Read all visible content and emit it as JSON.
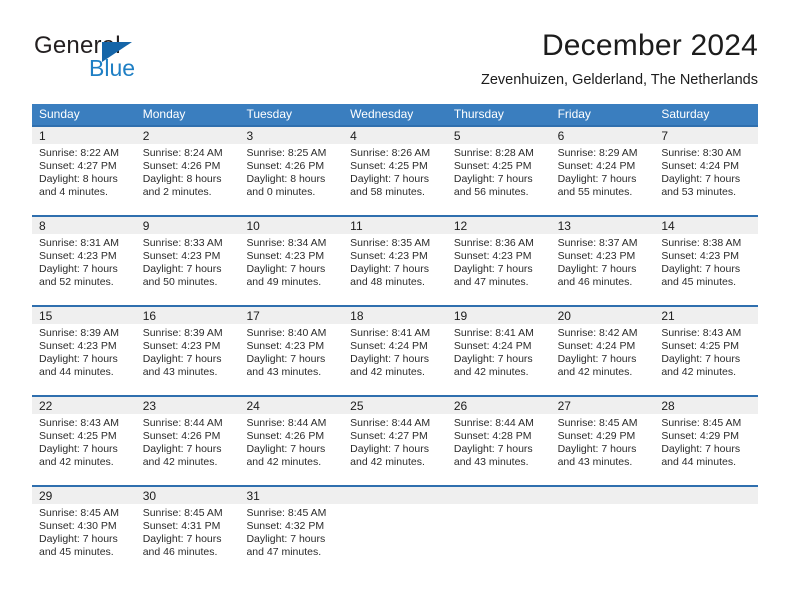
{
  "brand": {
    "name_part1": "General",
    "name_part2": "Blue",
    "triangle_color": "#1565a8",
    "blue_color": "#1f7fc4"
  },
  "header": {
    "title": "December 2024",
    "subtitle": "Zevenhuizen, Gelderland, The Netherlands"
  },
  "theme": {
    "header_blue": "#3a7ebf",
    "row_divider_blue": "#2f6fae",
    "day_band_gray": "#efefef"
  },
  "weekdays": [
    "Sunday",
    "Monday",
    "Tuesday",
    "Wednesday",
    "Thursday",
    "Friday",
    "Saturday"
  ],
  "weeks": [
    [
      {
        "day": "1",
        "sunrise": "Sunrise: 8:22 AM",
        "sunset": "Sunset: 4:27 PM",
        "daylight_line1": "Daylight: 8 hours",
        "daylight_line2": "and 4 minutes."
      },
      {
        "day": "2",
        "sunrise": "Sunrise: 8:24 AM",
        "sunset": "Sunset: 4:26 PM",
        "daylight_line1": "Daylight: 8 hours",
        "daylight_line2": "and 2 minutes."
      },
      {
        "day": "3",
        "sunrise": "Sunrise: 8:25 AM",
        "sunset": "Sunset: 4:26 PM",
        "daylight_line1": "Daylight: 8 hours",
        "daylight_line2": "and 0 minutes."
      },
      {
        "day": "4",
        "sunrise": "Sunrise: 8:26 AM",
        "sunset": "Sunset: 4:25 PM",
        "daylight_line1": "Daylight: 7 hours",
        "daylight_line2": "and 58 minutes."
      },
      {
        "day": "5",
        "sunrise": "Sunrise: 8:28 AM",
        "sunset": "Sunset: 4:25 PM",
        "daylight_line1": "Daylight: 7 hours",
        "daylight_line2": "and 56 minutes."
      },
      {
        "day": "6",
        "sunrise": "Sunrise: 8:29 AM",
        "sunset": "Sunset: 4:24 PM",
        "daylight_line1": "Daylight: 7 hours",
        "daylight_line2": "and 55 minutes."
      },
      {
        "day": "7",
        "sunrise": "Sunrise: 8:30 AM",
        "sunset": "Sunset: 4:24 PM",
        "daylight_line1": "Daylight: 7 hours",
        "daylight_line2": "and 53 minutes."
      }
    ],
    [
      {
        "day": "8",
        "sunrise": "Sunrise: 8:31 AM",
        "sunset": "Sunset: 4:23 PM",
        "daylight_line1": "Daylight: 7 hours",
        "daylight_line2": "and 52 minutes."
      },
      {
        "day": "9",
        "sunrise": "Sunrise: 8:33 AM",
        "sunset": "Sunset: 4:23 PM",
        "daylight_line1": "Daylight: 7 hours",
        "daylight_line2": "and 50 minutes."
      },
      {
        "day": "10",
        "sunrise": "Sunrise: 8:34 AM",
        "sunset": "Sunset: 4:23 PM",
        "daylight_line1": "Daylight: 7 hours",
        "daylight_line2": "and 49 minutes."
      },
      {
        "day": "11",
        "sunrise": "Sunrise: 8:35 AM",
        "sunset": "Sunset: 4:23 PM",
        "daylight_line1": "Daylight: 7 hours",
        "daylight_line2": "and 48 minutes."
      },
      {
        "day": "12",
        "sunrise": "Sunrise: 8:36 AM",
        "sunset": "Sunset: 4:23 PM",
        "daylight_line1": "Daylight: 7 hours",
        "daylight_line2": "and 47 minutes."
      },
      {
        "day": "13",
        "sunrise": "Sunrise: 8:37 AM",
        "sunset": "Sunset: 4:23 PM",
        "daylight_line1": "Daylight: 7 hours",
        "daylight_line2": "and 46 minutes."
      },
      {
        "day": "14",
        "sunrise": "Sunrise: 8:38 AM",
        "sunset": "Sunset: 4:23 PM",
        "daylight_line1": "Daylight: 7 hours",
        "daylight_line2": "and 45 minutes."
      }
    ],
    [
      {
        "day": "15",
        "sunrise": "Sunrise: 8:39 AM",
        "sunset": "Sunset: 4:23 PM",
        "daylight_line1": "Daylight: 7 hours",
        "daylight_line2": "and 44 minutes."
      },
      {
        "day": "16",
        "sunrise": "Sunrise: 8:39 AM",
        "sunset": "Sunset: 4:23 PM",
        "daylight_line1": "Daylight: 7 hours",
        "daylight_line2": "and 43 minutes."
      },
      {
        "day": "17",
        "sunrise": "Sunrise: 8:40 AM",
        "sunset": "Sunset: 4:23 PM",
        "daylight_line1": "Daylight: 7 hours",
        "daylight_line2": "and 43 minutes."
      },
      {
        "day": "18",
        "sunrise": "Sunrise: 8:41 AM",
        "sunset": "Sunset: 4:24 PM",
        "daylight_line1": "Daylight: 7 hours",
        "daylight_line2": "and 42 minutes."
      },
      {
        "day": "19",
        "sunrise": "Sunrise: 8:41 AM",
        "sunset": "Sunset: 4:24 PM",
        "daylight_line1": "Daylight: 7 hours",
        "daylight_line2": "and 42 minutes."
      },
      {
        "day": "20",
        "sunrise": "Sunrise: 8:42 AM",
        "sunset": "Sunset: 4:24 PM",
        "daylight_line1": "Daylight: 7 hours",
        "daylight_line2": "and 42 minutes."
      },
      {
        "day": "21",
        "sunrise": "Sunrise: 8:43 AM",
        "sunset": "Sunset: 4:25 PM",
        "daylight_line1": "Daylight: 7 hours",
        "daylight_line2": "and 42 minutes."
      }
    ],
    [
      {
        "day": "22",
        "sunrise": "Sunrise: 8:43 AM",
        "sunset": "Sunset: 4:25 PM",
        "daylight_line1": "Daylight: 7 hours",
        "daylight_line2": "and 42 minutes."
      },
      {
        "day": "23",
        "sunrise": "Sunrise: 8:44 AM",
        "sunset": "Sunset: 4:26 PM",
        "daylight_line1": "Daylight: 7 hours",
        "daylight_line2": "and 42 minutes."
      },
      {
        "day": "24",
        "sunrise": "Sunrise: 8:44 AM",
        "sunset": "Sunset: 4:26 PM",
        "daylight_line1": "Daylight: 7 hours",
        "daylight_line2": "and 42 minutes."
      },
      {
        "day": "25",
        "sunrise": "Sunrise: 8:44 AM",
        "sunset": "Sunset: 4:27 PM",
        "daylight_line1": "Daylight: 7 hours",
        "daylight_line2": "and 42 minutes."
      },
      {
        "day": "26",
        "sunrise": "Sunrise: 8:44 AM",
        "sunset": "Sunset: 4:28 PM",
        "daylight_line1": "Daylight: 7 hours",
        "daylight_line2": "and 43 minutes."
      },
      {
        "day": "27",
        "sunrise": "Sunrise: 8:45 AM",
        "sunset": "Sunset: 4:29 PM",
        "daylight_line1": "Daylight: 7 hours",
        "daylight_line2": "and 43 minutes."
      },
      {
        "day": "28",
        "sunrise": "Sunrise: 8:45 AM",
        "sunset": "Sunset: 4:29 PM",
        "daylight_line1": "Daylight: 7 hours",
        "daylight_line2": "and 44 minutes."
      }
    ],
    [
      {
        "day": "29",
        "sunrise": "Sunrise: 8:45 AM",
        "sunset": "Sunset: 4:30 PM",
        "daylight_line1": "Daylight: 7 hours",
        "daylight_line2": "and 45 minutes."
      },
      {
        "day": "30",
        "sunrise": "Sunrise: 8:45 AM",
        "sunset": "Sunset: 4:31 PM",
        "daylight_line1": "Daylight: 7 hours",
        "daylight_line2": "and 46 minutes."
      },
      {
        "day": "31",
        "sunrise": "Sunrise: 8:45 AM",
        "sunset": "Sunset: 4:32 PM",
        "daylight_line1": "Daylight: 7 hours",
        "daylight_line2": "and 47 minutes."
      },
      {
        "day": "",
        "sunrise": "",
        "sunset": "",
        "daylight_line1": "",
        "daylight_line2": ""
      },
      {
        "day": "",
        "sunrise": "",
        "sunset": "",
        "daylight_line1": "",
        "daylight_line2": ""
      },
      {
        "day": "",
        "sunrise": "",
        "sunset": "",
        "daylight_line1": "",
        "daylight_line2": ""
      },
      {
        "day": "",
        "sunrise": "",
        "sunset": "",
        "daylight_line1": "",
        "daylight_line2": ""
      }
    ]
  ]
}
